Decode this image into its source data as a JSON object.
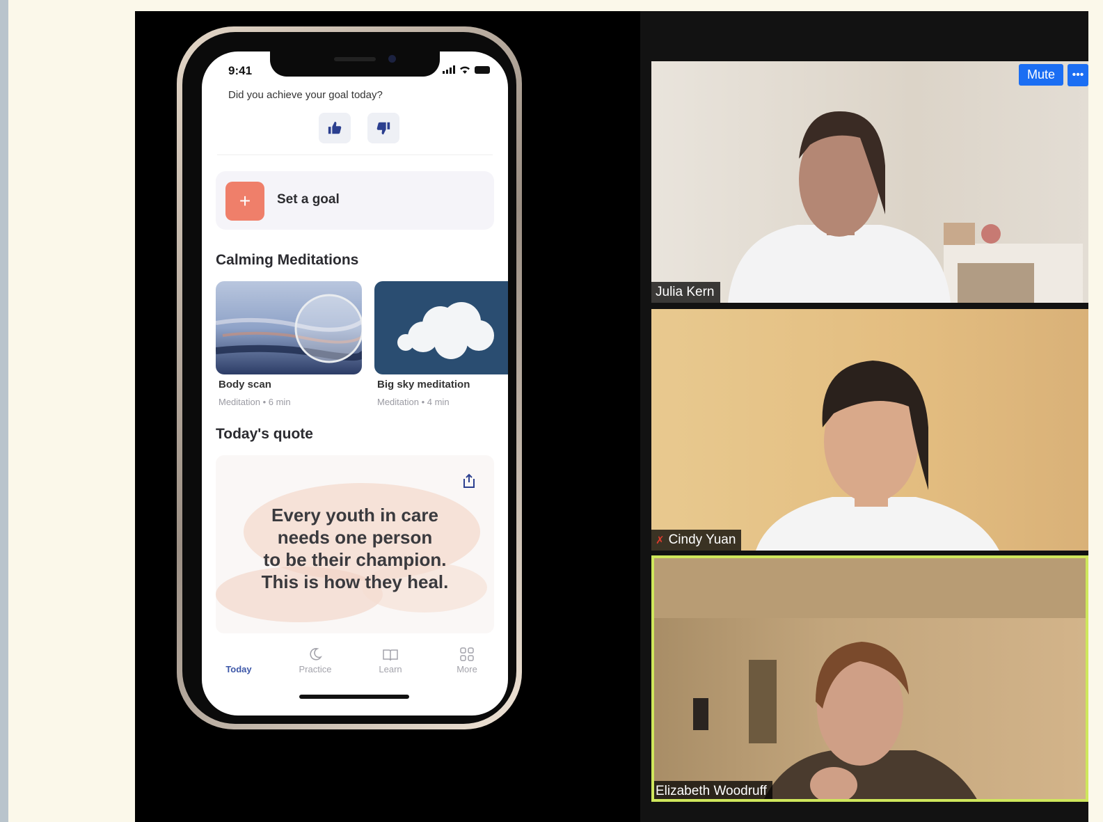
{
  "phone": {
    "status_time": "9:41",
    "goal_question": "Did you achieve your goal today?",
    "set_goal_label": "Set a goal",
    "set_goal_icon": "+",
    "calming_title": "Calming Meditations",
    "cards": [
      {
        "title": "Body scan",
        "subtitle": "Meditation • 6 min"
      },
      {
        "title": "Big sky meditation",
        "subtitle": "Meditation • 4 min"
      }
    ],
    "quote_title": "Today's quote",
    "quote_lines": [
      "Every youth in care",
      "needs one person",
      "to be their champion.",
      "This is how they heal."
    ],
    "tabs": [
      {
        "label": "Today",
        "icon": "sun-icon",
        "active": true
      },
      {
        "label": "Practice",
        "icon": "moon-icon",
        "active": false
      },
      {
        "label": "Learn",
        "icon": "book-icon",
        "active": false
      },
      {
        "label": "More",
        "icon": "grid-icon",
        "active": false
      }
    ]
  },
  "meeting": {
    "mute_label": "Mute",
    "more_label": "•••",
    "participants": [
      {
        "name": "Julia Kern",
        "muted": false,
        "active_speaker": false
      },
      {
        "name": "Cindy Yuan",
        "muted": true,
        "active_speaker": false
      },
      {
        "name": "Elizabeth Woodruff",
        "muted": false,
        "active_speaker": true
      }
    ]
  },
  "colors": {
    "accent_goal": "#ef7f6a",
    "active_tab": "#3d57a8",
    "zoom_blue": "#1b6ef3",
    "active_speaker_border": "#cfe75c"
  }
}
